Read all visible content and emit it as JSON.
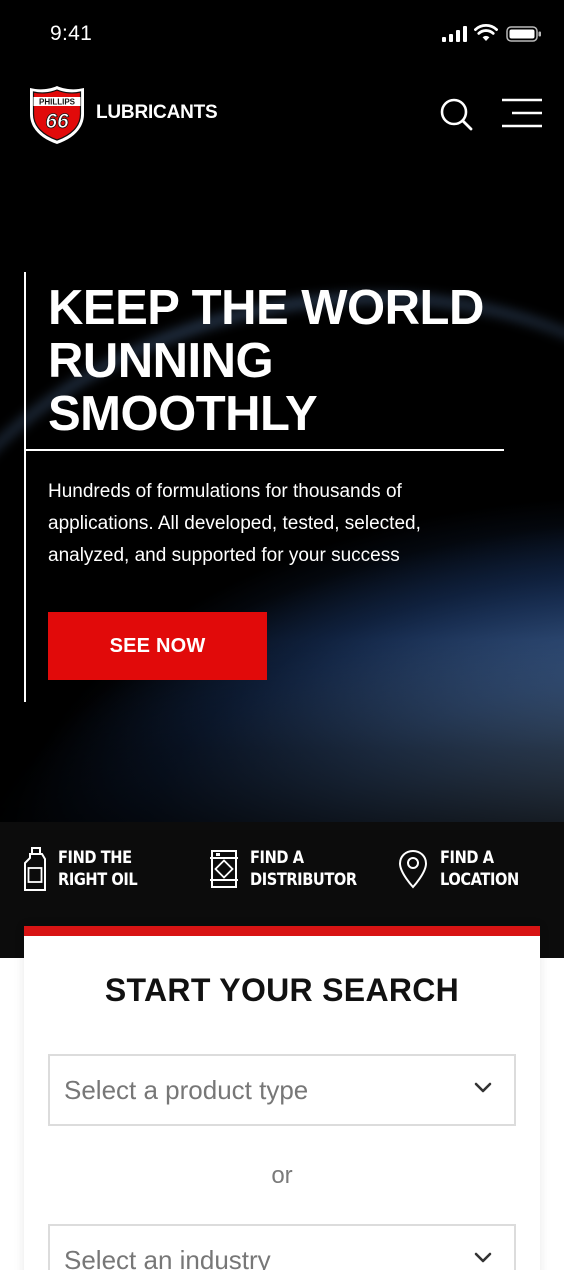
{
  "status_bar": {
    "time": "9:41",
    "icons": [
      "cellular-signal-icon",
      "wifi-icon",
      "battery-icon"
    ]
  },
  "nav": {
    "brand": "LUBRICANTS",
    "logo": {
      "top_text": "PHILLIPS",
      "number": "66"
    },
    "icons": [
      "search-icon",
      "hamburger-menu-icon"
    ]
  },
  "hero": {
    "title_lines": [
      "KEEP THE WORLD",
      "RUNNING",
      "SMOOTHLY"
    ],
    "subtitle": "Hundreds of formulations for thousands of applications. All developed, tested, selected, analyzed, and supported for your success",
    "cta_label": "SEE NOW"
  },
  "quick_links": [
    {
      "label": "FIND THE\nRIGHT OIL",
      "icon": "oil-bottle-icon"
    },
    {
      "label": "FIND A\nDISTRIBUTOR",
      "icon": "barrel-icon"
    },
    {
      "label": "FIND A\nLOCATION",
      "icon": "map-pin-icon"
    }
  ],
  "search_card": {
    "title_regular": "START YOUR ",
    "title_bold": "SEARCH",
    "select_product_placeholder": "Select a product type",
    "or_text": "or",
    "select_industry_placeholder": "Select an industry"
  },
  "colors": {
    "accent_red": "#e10a0a",
    "dark_background": "#000000",
    "strip_background": "#0c0c0c"
  }
}
